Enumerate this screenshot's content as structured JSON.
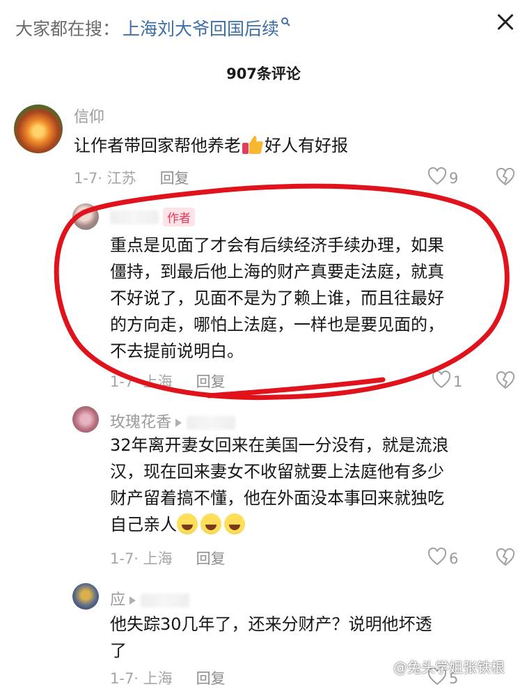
{
  "search": {
    "prefix": "大家都在搜：",
    "term": "上海刘大爷回国后续"
  },
  "header": {
    "comment_count": "907条评论"
  },
  "comments": [
    {
      "name": "信仰",
      "text_before_emoji": "让作者带回家帮他养老",
      "text_after_emoji": "好人有好报",
      "date_region": "1-7· 江苏",
      "reply_label": "回复",
      "likes": "9"
    },
    {
      "badge": "作者",
      "text_lines": [
        "重点是见面了才会有后续经济手续办理，如果",
        "僵持，到最后他上海的财产真要走法庭，就真",
        "不好说了，见面不是为了赖上谁，而且往最好",
        "的方向走，哪怕上法庭，一样也是要见面的，",
        "不去提前说明白。"
      ],
      "date_region": "1-7· 上海",
      "reply_label": "回复",
      "likes": "1"
    },
    {
      "name": "玫瑰花香",
      "text_lines": [
        "32年离开妻女回来在美国一分没有，就是流浪",
        "汉，现在回来妻女不收留就要上法庭他有多少",
        "财产留着搞不懂，他在外面没本事回来就独吃",
        "自己亲人"
      ],
      "date_region": "1-7· 上海",
      "reply_label": "回复",
      "likes": "6"
    },
    {
      "name": "应",
      "text_lines": [
        "他失踪30几年了，还来分财产？说明他坏透",
        "了"
      ],
      "date_region": "1-7· 上海",
      "reply_label": "回复",
      "likes": "5"
    }
  ],
  "watermark": "@兔头学姐张铁根",
  "colors": {
    "accent_link": "#3d6ea8",
    "annotation_red": "#e0121b",
    "author_badge": "#e8365a"
  }
}
